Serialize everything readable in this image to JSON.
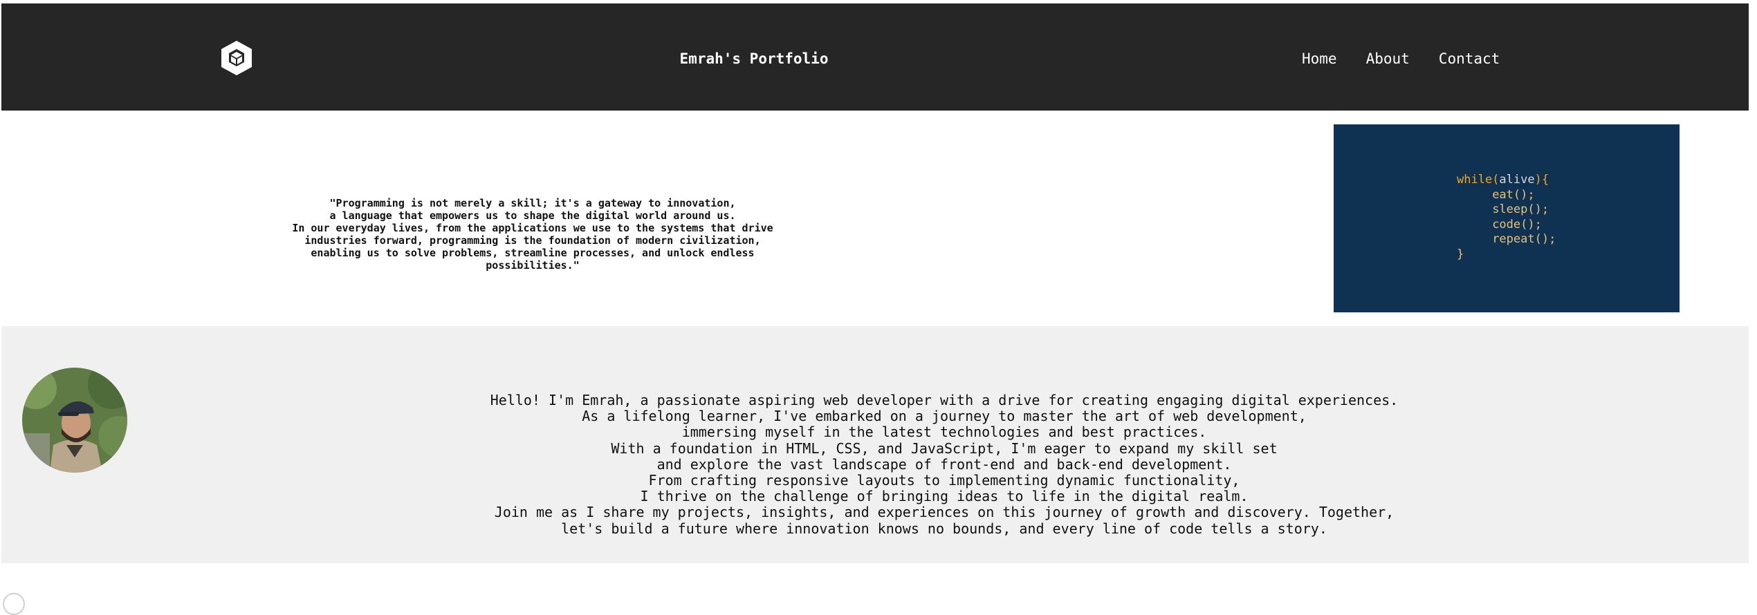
{
  "header": {
    "title": "Emrah's Portfolio",
    "logo_icon": "cube-logo-icon",
    "nav": [
      {
        "label": "Home"
      },
      {
        "label": "About"
      },
      {
        "label": "Contact"
      }
    ]
  },
  "hero": {
    "quote": "\"Programming is not merely a skill; it's a gateway to innovation,\na language that empowers us to shape the digital world around us.\nIn our everyday lives, from the applications we use to the systems that drive\nindustries forward, programming is the foundation of modern civilization,\nenabling us to solve problems, streamline processes, and unlock endless possibilities.\"",
    "code_lines": {
      "line1_kw": "while(",
      "line1_arg": "alive",
      "line1_end": "){",
      "line2": "eat();",
      "line3": "sleep();",
      "line4": "code();",
      "line5": "repeat();",
      "line6": "}"
    }
  },
  "about": {
    "avatar": "profile-photo",
    "bio": "Hello! I'm Emrah, a passionate aspiring web developer with a drive for creating engaging digital experiences.\nAs a lifelong learner, I've embarked on a journey to master the art of web development,\nimmersing myself in the latest technologies and best practices.\nWith a foundation in HTML, CSS, and JavaScript, I'm eager to expand my skill set\nand explore the vast landscape of front-end and back-end development.\nFrom crafting responsive layouts to implementing dynamic functionality,\nI thrive on the challenge of bringing ideas to life in the digital realm.\nJoin me as I share my projects, insights, and experiences on this journey of growth and discovery. Together,\nlet's build a future where innovation knows no bounds, and every line of code tells a story."
  },
  "colors": {
    "header_bg": "#262626",
    "code_bg": "#0f3252",
    "about_bg": "#f0f0f0",
    "code_keyword": "#f5a623"
  }
}
